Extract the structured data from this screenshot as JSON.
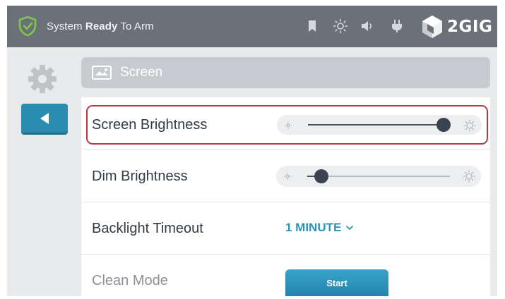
{
  "status_bar": {
    "status_prefix": "System ",
    "status_bold": "Ready",
    "status_suffix": " To Arm",
    "brand": "2GIG",
    "icons": [
      "shield-check-icon",
      "bookmark-icon",
      "brightness-icon",
      "volume-icon",
      "power-plug-icon",
      "2gig-logo-icon"
    ]
  },
  "nav": {
    "settings_icon": "gear-icon",
    "back_icon": "back-arrow-icon"
  },
  "section": {
    "icon": "screen-icon",
    "title": "Screen"
  },
  "settings": {
    "screen_brightness": {
      "label": "Screen Brightness",
      "level": 0.95,
      "selected": true
    },
    "dim_brightness": {
      "label": "Dim Brightness",
      "level": 0.1
    },
    "backlight_timeout": {
      "label": "Backlight Timeout",
      "value": "1 MINUTE"
    },
    "clean_mode": {
      "label": "Clean Mode",
      "button": "Start"
    }
  },
  "colors": {
    "status_bar": "#6b7079",
    "accent": "#2a8cb1",
    "shield": "#7cc84a",
    "selection": "#b53a3f",
    "link": "#2b93bb"
  }
}
